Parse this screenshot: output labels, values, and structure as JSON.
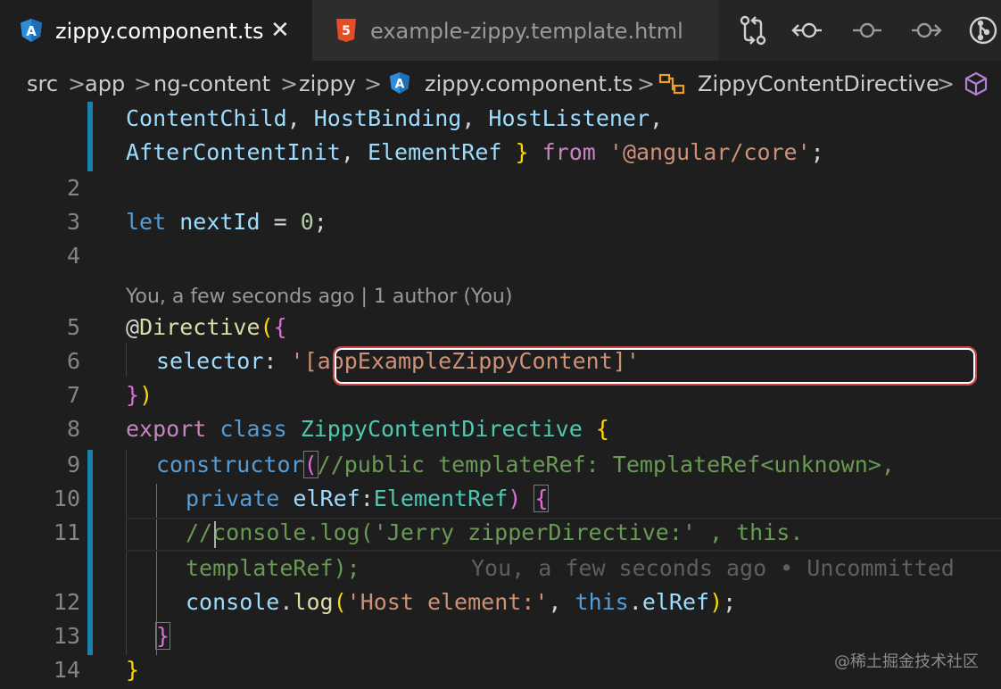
{
  "tabs": [
    {
      "label": "zippy.component.ts",
      "icon": "angular-icon",
      "active": true
    },
    {
      "label": "example-zippy.template.html",
      "icon": "html5-icon",
      "active": false
    }
  ],
  "toolbar_icons": [
    "compare-changes-icon",
    "previous-change-icon",
    "commit-icon",
    "next-change-icon",
    "git-graph-icon"
  ],
  "breadcrumb": [
    "src",
    "app",
    "ng-content",
    "zippy",
    "zippy.component.ts",
    "ZippyContentDirective"
  ],
  "separator": ">",
  "codelens": "You, a few seconds ago | 1 author (You)",
  "inline_blame": "You, a few seconds ago • Uncommitted",
  "code": {
    "import_line_a": [
      "ContentChild",
      ", ",
      "HostBinding",
      ", ",
      "HostListener",
      ","
    ],
    "import_line_b": [
      "AfterContentInit",
      ", ",
      "ElementRef",
      " } ",
      "from",
      " ",
      "'@angular/core'",
      ";"
    ],
    "line3": [
      "let",
      " ",
      "nextId",
      " = ",
      "0",
      ";"
    ],
    "line5": [
      "@",
      "Directive",
      "(",
      "{"
    ],
    "line6": [
      "selector",
      ": ",
      "'[appExampleZippyContent]'"
    ],
    "line7": [
      "}",
      ")"
    ],
    "line8": [
      "export",
      " ",
      "class",
      " ",
      "ZippyContentDirective",
      " ",
      "{"
    ],
    "line9": [
      "constructor",
      "(",
      "//public templateRef: TemplateRef<unknown>,"
    ],
    "line10": [
      "private",
      " ",
      "elRef",
      ":",
      "ElementRef",
      ")",
      " ",
      "{"
    ],
    "line11a": [
      "//",
      "console.log('Jerry zipperDirective:' , this."
    ],
    "line11b": [
      "templateRef);"
    ],
    "line12": [
      "console",
      ".",
      "log",
      "(",
      "'Host element:'",
      ", ",
      "this",
      ".",
      "elRef",
      ")",
      ";"
    ],
    "line13": [
      "}"
    ],
    "line14": [
      "}"
    ]
  },
  "line_numbers": [
    "2",
    "3",
    "4",
    "5",
    "6",
    "7",
    "8",
    "9",
    "10",
    "11",
    "12",
    "13",
    "14"
  ],
  "watermark": "@稀土掘金技术社区",
  "colors": {
    "editor_bg": "#1e1e1e",
    "highlight_border": "#c94a4a",
    "git_gutter": "#1b81a8"
  }
}
